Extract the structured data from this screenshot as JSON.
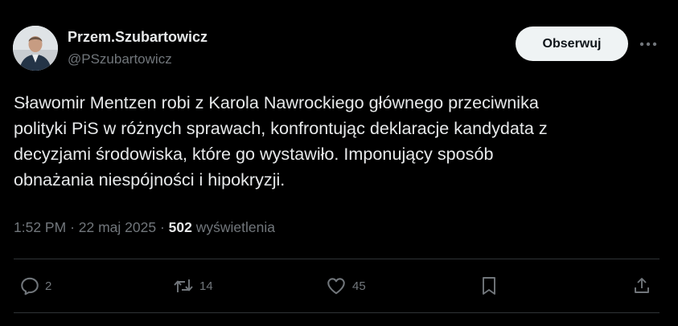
{
  "author": {
    "name": "Przem.Szubartowicz",
    "handle": "@PSzubartowicz"
  },
  "follow_button": "Obserwuj",
  "more_icon": "more-horizontal-icon",
  "tweet": {
    "text": "Sławomir Mentzen robi z Karola Nawrockiego głównego przeciwnika\npolityki PiS w różnych sprawach, konfrontując deklaracje kandydata z\ndecyzjami środowiska, które go wystawiło. Imponujący sposób\nobnażania niespójności i hipokryzji.",
    "time": "1:52 PM",
    "date": "22 maj 2025",
    "views": "502",
    "views_label": "wyświetlenia"
  },
  "actions": {
    "replies": "2",
    "reposts": "14",
    "likes": "45"
  },
  "colors": {
    "background": "#000000",
    "text": "#e7e9ea",
    "secondary_text": "#71767b",
    "divider": "#2f3336",
    "button_bg": "#eff3f4"
  }
}
